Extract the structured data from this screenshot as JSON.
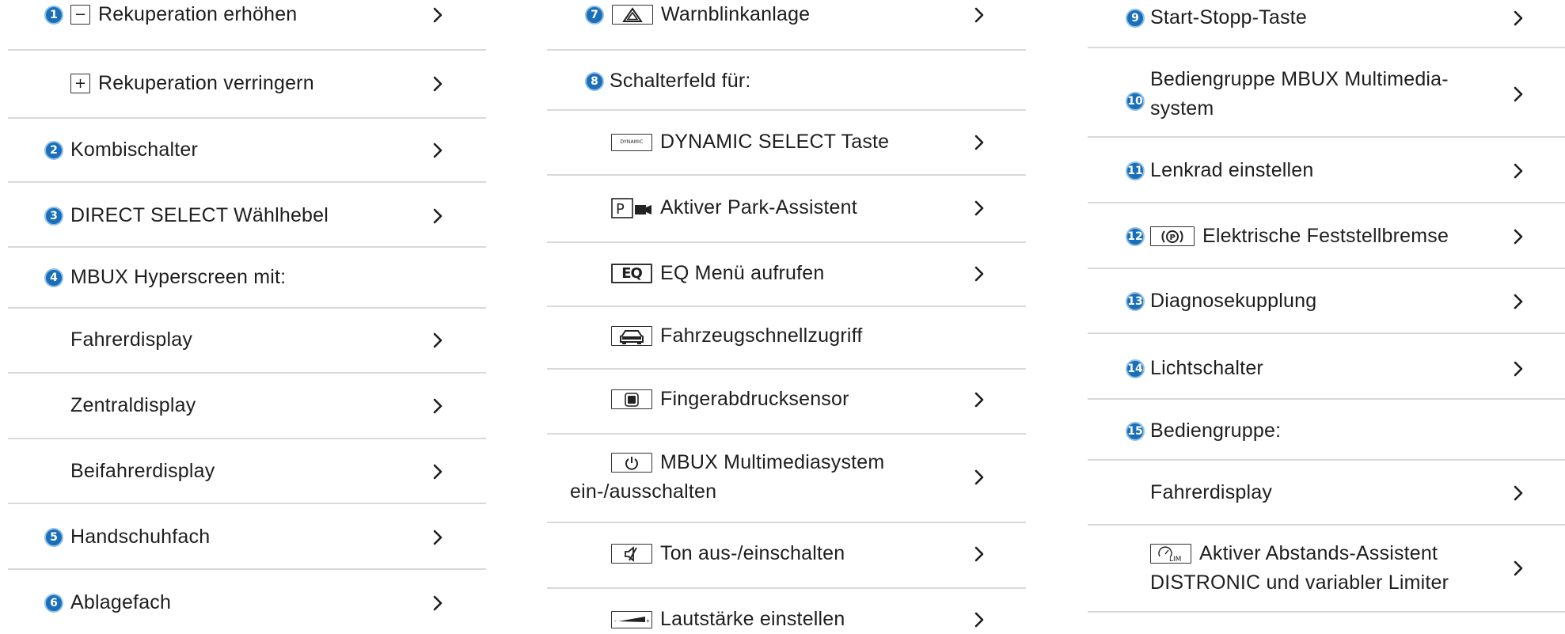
{
  "column1": {
    "items": [
      {
        "number": "1",
        "icon": "minus-icon",
        "label": "Rekuperation erhöhen"
      },
      {
        "icon": "plus-icon",
        "label": "Rekuperation verringern"
      },
      {
        "number": "2",
        "label": "Kombischalter"
      },
      {
        "number": "3",
        "label": "DIRECT SELECT Wählhebel"
      },
      {
        "number": "4",
        "label": "MBUX Hyperscreen mit:"
      },
      {
        "label": "Fahrerdisplay"
      },
      {
        "label": "Zentraldisplay"
      },
      {
        "label": "Beifahrerdisplay"
      },
      {
        "number": "5",
        "label": "Handschuhfach"
      },
      {
        "number": "6",
        "label": "Ablagefach"
      }
    ]
  },
  "column2": {
    "items": [
      {
        "number": "7",
        "icon": "hazard-warning-icon",
        "label": "Warnblinkanlage"
      },
      {
        "number": "8",
        "label": "Schalterfeld für:"
      },
      {
        "icon": "dynamic-select-icon",
        "icon_text": "DYNAMIC",
        "label": "DYNAMIC SELECT Taste"
      },
      {
        "icon": "park-assist-icon",
        "icon_text": "P",
        "label": "Aktiver Park-Assistent"
      },
      {
        "icon": "eq-menu-icon",
        "icon_text": "EQ",
        "label": "EQ Menü aufrufen"
      },
      {
        "icon": "vehicle-quick-access-icon",
        "label": "Fahrzeugschnellzugriff"
      },
      {
        "icon": "fingerprint-sensor-icon",
        "label": "Fingerabdrucksensor"
      },
      {
        "icon": "power-icon",
        "label_line1": "MBUX Multimediasystem",
        "label_line2": "ein-/ausschalten"
      },
      {
        "icon": "mute-icon",
        "label": "Ton aus-/einschalten"
      },
      {
        "icon": "volume-icon",
        "label": "Lautstärke einstellen"
      }
    ]
  },
  "column3": {
    "items": [
      {
        "number": "9",
        "label": "Start-Stopp-Taste"
      },
      {
        "number": "10",
        "label_line1": "Bediengruppe MBUX Multimedia-",
        "label_line2": "system"
      },
      {
        "number": "11",
        "label": "Lenkrad einstellen"
      },
      {
        "number": "12",
        "icon": "parking-brake-icon",
        "icon_text": "(P)",
        "label": "Elektrische Feststellbremse"
      },
      {
        "number": "13",
        "label": "Diagnosekupplung"
      },
      {
        "number": "14",
        "label": "Lichtschalter"
      },
      {
        "number": "15",
        "label": "Bediengruppe:"
      },
      {
        "label": "Fahrerdisplay"
      },
      {
        "icon": "distronic-lim-icon",
        "icon_text": "LIM",
        "label_line1": "Aktiver Abstands-Assistent",
        "label_line2": "DISTRONIC und variabler Limiter"
      }
    ]
  },
  "colors": {
    "number_badge": "#1a6fb8",
    "badge_ring": "#8fc0e8",
    "text": "#1e1e1e",
    "divider": "#d9d9d9",
    "chevron": "#1e1e1e"
  }
}
